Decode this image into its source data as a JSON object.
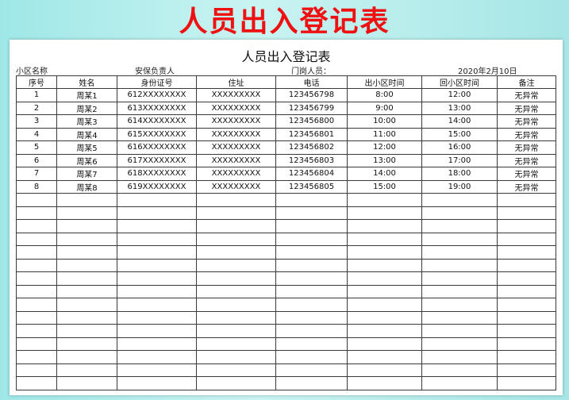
{
  "banner_title": "人员出入登记表",
  "sheet": {
    "title": "人员出入登记表",
    "meta": {
      "community_label": "小区名称",
      "security_label": "安保负责人",
      "gate_label": "门岗人员：",
      "date": "2020年2月10日"
    },
    "columns": [
      "序号",
      "姓名",
      "身份证号",
      "住址",
      "电话",
      "出小区时间",
      "回小区时间",
      "备注"
    ],
    "rows": [
      [
        "1",
        "周某1",
        "612XXXXXXXX",
        "XXXXXXXXX",
        "123456798",
        "8:00",
        "12:00",
        "无异常"
      ],
      [
        "2",
        "周某2",
        "613XXXXXXXX",
        "XXXXXXXXX",
        "123456799",
        "9:00",
        "13:00",
        "无异常"
      ],
      [
        "3",
        "周某3",
        "614XXXXXXXX",
        "XXXXXXXXX",
        "123456800",
        "10:00",
        "14:00",
        "无异常"
      ],
      [
        "4",
        "周某4",
        "615XXXXXXXX",
        "XXXXXXXXX",
        "123456801",
        "11:00",
        "15:00",
        "无异常"
      ],
      [
        "5",
        "周某5",
        "616XXXXXXXX",
        "XXXXXXXXX",
        "123456802",
        "12:00",
        "16:00",
        "无异常"
      ],
      [
        "6",
        "周某6",
        "617XXXXXXXX",
        "XXXXXXXXX",
        "123456803",
        "13:00",
        "17:00",
        "无异常"
      ],
      [
        "7",
        "周某7",
        "618XXXXXXXX",
        "XXXXXXXXX",
        "123456804",
        "14:00",
        "18:00",
        "无异常"
      ],
      [
        "8",
        "周某8",
        "619XXXXXXXX",
        "XXXXXXXXX",
        "123456805",
        "15:00",
        "19:00",
        "无异常"
      ]
    ],
    "blank_rows": 15
  }
}
